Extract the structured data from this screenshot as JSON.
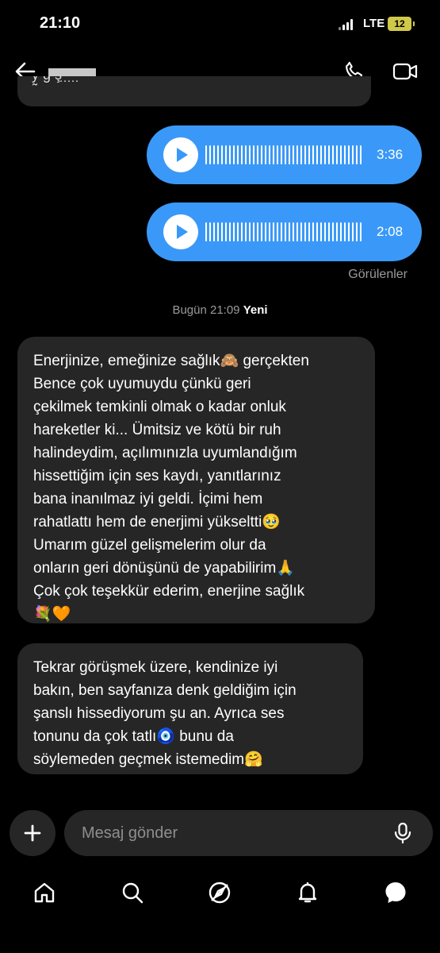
{
  "status_bar": {
    "time": "21:10",
    "network": "LTE",
    "battery": "12"
  },
  "conversation": {
    "voice_messages": [
      {
        "duration": "3:36"
      },
      {
        "duration": "2:08"
      }
    ],
    "seen_label": "Görülenler",
    "date_divider": {
      "time": "Bugün 21:09",
      "new_label": "Yeni"
    },
    "messages": [
      {
        "text": "Enerjinize, emeğinize sağlık🙈 gerçekten\nBence çok uyumuydu çünkü geri\nçekilmek temkinli olmak o kadar onluk\nhareketler ki... Ümitsiz ve kötü bir ruh\nhalindeydim, açılımınızla uyumlandığım\nhissettiğim için ses kaydı, yanıtlarınız\nbana inanılmaz iyi geldi. İçimi hem\nrahatlattı hem de enerjimi yükseltti🥹\nUmarım güzel gelişmelerim olur da\nonların geri dönüşünü de yapabilirim🙏\nÇok çok teşekkür ederim, enerjine sağlık\n💐🧡"
      },
      {
        "text": "Tekrar görüşmek üzere, kendinize iyi\nbakın, ben sayfanıza denk geldiğim için\nşanslı hissediyorum şu an. Ayrıca ses\ntonunu da çok tatlı🧿 bunu da\nsöylemeden geçmek istemedim🤗"
      }
    ]
  },
  "composer": {
    "placeholder": "Mesaj gönder"
  },
  "icons": [
    "back-arrow-icon",
    "phone-icon",
    "video-camera-icon",
    "play-icon",
    "plus-icon",
    "microphone-icon",
    "home-icon",
    "search-icon",
    "explore-compass-icon",
    "notifications-bell-icon",
    "messages-icon"
  ],
  "colors": {
    "background": "#000000",
    "incoming_bubble": "#262626",
    "outgoing_voice_bubble": "#3a99f8",
    "muted_text": "#9a9a9a",
    "battery": "#cfc84a"
  }
}
